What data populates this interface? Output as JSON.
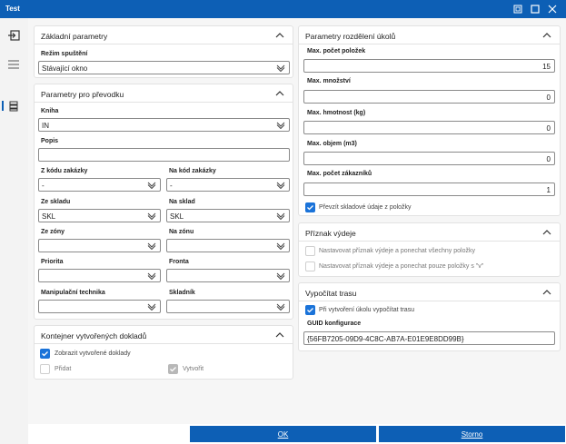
{
  "window": {
    "title": "Test"
  },
  "basic": {
    "title": "Základní parametry",
    "mode_label": "Režim spuštění",
    "mode_value": "Stávající okno"
  },
  "transfer": {
    "title": "Parametry pro převodku",
    "book_label": "Kniha",
    "book_value": "IN",
    "desc_label": "Popis",
    "desc_value": "",
    "from_order_label": "Z kódu zakázky",
    "from_order_value": "-",
    "to_order_label": "Na kód zakázky",
    "to_order_value": "-",
    "from_store_label": "Ze skladu",
    "from_store_value": "SKL",
    "to_store_label": "Na sklad",
    "to_store_value": "SKL",
    "from_zone_label": "Ze zóny",
    "from_zone_value": "",
    "to_zone_label": "Na zónu",
    "to_zone_value": "",
    "priority_label": "Priorita",
    "priority_value": "",
    "queue_label": "Fronta",
    "queue_value": "",
    "tech_label": "Manipulační technika",
    "tech_value": "",
    "storekeeper_label": "Skladník",
    "storekeeper_value": ""
  },
  "container": {
    "title": "Kontejner vytvořených dokladů",
    "show_label": "Zobrazit vytvořené doklady",
    "add_label": "Přidat",
    "create_label": "Vytvořit"
  },
  "split": {
    "title": "Parametry rozdělení úkolů",
    "max_items_label": "Max. počet položek",
    "max_items_value": "15",
    "max_qty_label": "Max. množství",
    "max_qty_value": "0",
    "max_weight_label": "Max. hmotnost (kg)",
    "max_weight_value": "0",
    "max_volume_label": "Max. objem (m3)",
    "max_volume_value": "0",
    "max_customers_label": "Max. počet zákazníků",
    "max_customers_value": "1",
    "take_store_label": "Převzít skladové údaje z položky"
  },
  "flag": {
    "title": "Příznak výdeje",
    "opt1_label": "Nastavovat příznak výdeje a ponechat všechny položky",
    "opt2_label": "Nastavovat příznak výdeje a ponechat pouze položky s \"v\""
  },
  "route": {
    "title": "Vypočítat trasu",
    "calc_label": "Při vytvoření úkolu vypočítat trasu",
    "guid_label": "GUID konfigurace",
    "guid_value": "{56FB7205-09D9-4C8C-AB7A-E01E9E8DD99B}"
  },
  "buttons": {
    "ok": "OK",
    "cancel": "Storno"
  },
  "colors": {
    "accent": "#0d5fb5",
    "checkbox": "#1a73d9"
  }
}
